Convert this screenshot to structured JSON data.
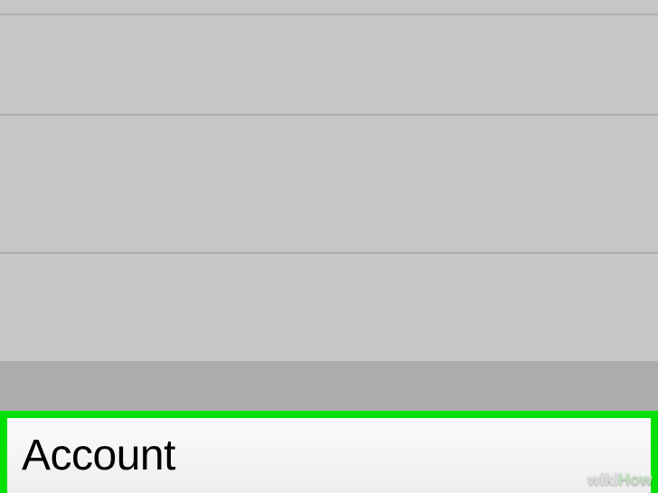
{
  "settings": {
    "account_row_label": "Account"
  },
  "watermark": {
    "part1": "wiki",
    "part2": "How"
  },
  "highlight": {
    "border_color": "#00e000"
  }
}
